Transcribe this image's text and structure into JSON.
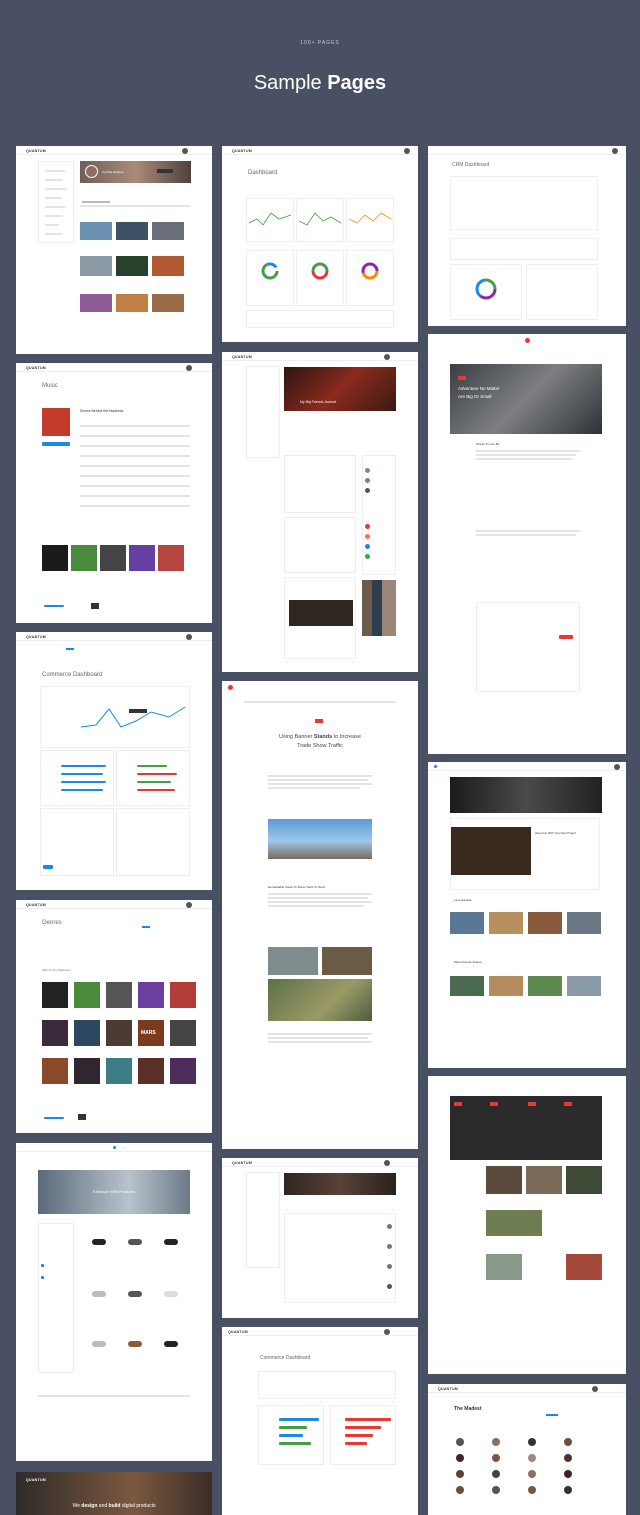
{
  "header": {
    "kicker": "100+ PAGES",
    "title_regular": "Sample ",
    "title_bold": "Pages"
  },
  "brand": "QUANTUM",
  "cards": {
    "profile": {
      "name": "Cynthia Hughes"
    },
    "dashboard": {
      "title": "Dashboard"
    },
    "crm": {
      "title": "CRM Dashboard"
    },
    "music": {
      "title": "Music",
      "album": "Shows Behind the Madness"
    },
    "social": {
      "hero": "My Big Friends Journal"
    },
    "blog_red": {
      "hero_line1": "Adventure No Matter",
      "hero_line2": "Are Big Or Small",
      "section": "Words To Live By"
    },
    "commerce": {
      "title": "Commerce Dashboard"
    },
    "article": {
      "title_part1": "Using Banner ",
      "title_bold": "Stands",
      "title_part2": " to Increase",
      "title_line2": "Trade Show Traffic",
      "subhead": "Remarkable Vision To Boost Tools To Work"
    },
    "genres": {
      "title": "Genres",
      "section": "Albums For Madness",
      "tile": "MARS"
    },
    "video": {
      "title": "Have Fun With Your Next Project",
      "last_uploads": "Last Uploads",
      "most_popular": "Most Popular Videos"
    },
    "shop": {
      "hero": "Enhance With Products"
    },
    "news": {},
    "commerce2": {
      "title": "Commerce Dashboard"
    },
    "madest": {
      "title": "The Madest"
    },
    "agency": {
      "line1_pre": "We ",
      "line1_b1": "design",
      "line1_mid": " and ",
      "line1_b2": "build",
      "line1_post": " digital products"
    }
  },
  "colors": {
    "bg": "#4a5064",
    "accent_red": "#e53935",
    "accent_blue": "#1e88e5"
  }
}
